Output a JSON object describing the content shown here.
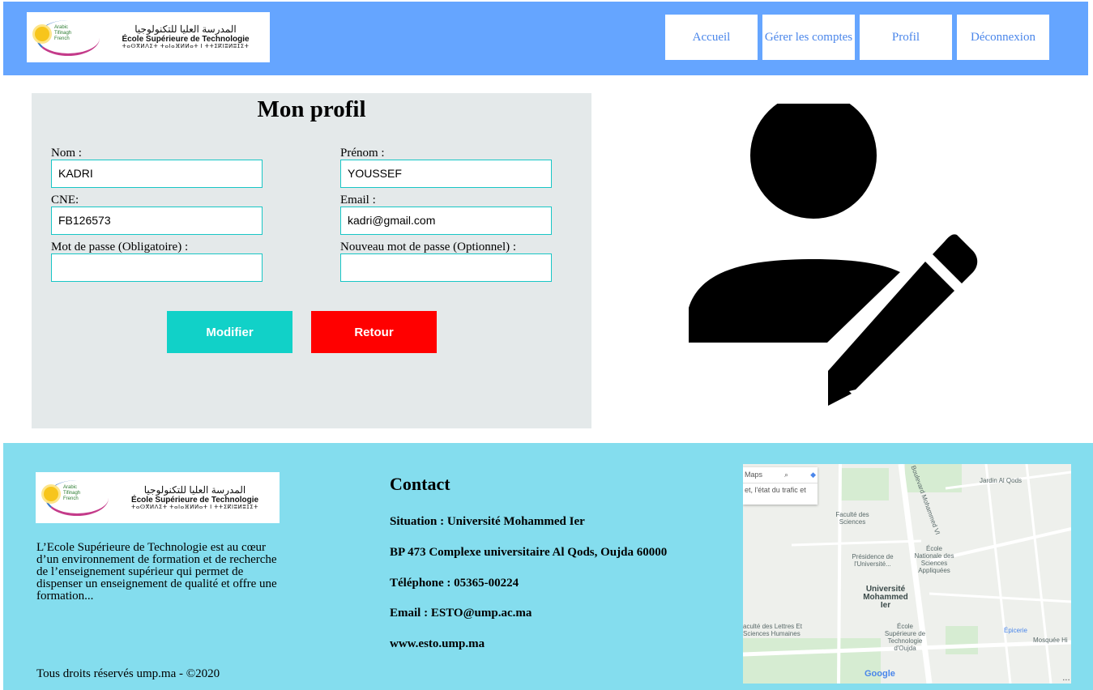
{
  "header": {
    "logo": {
      "arabic": "المدرسة العليا للتكنولوجيا",
      "french": "École Supérieure de Technologie",
      "tifinagh": "ⵜⴰⵙⴳⵍⴷⵉⵜ ⵜⴰⵏⴰⴼⵍⵍⴰⵜ ⵏ ⵜⵜⵉⴽⵏⵓⵍⵓⵊⵉⵜ"
    },
    "nav": [
      "Accueil",
      "Gérer les comptes",
      "Profil",
      "Déconnexion"
    ]
  },
  "profile": {
    "title": "Mon profil",
    "fields": {
      "nom": {
        "label": "Nom :",
        "value": "KADRI"
      },
      "prenom": {
        "label": "Prénom :",
        "value": "YOUSSEF"
      },
      "cne": {
        "label": "CNE:",
        "value": "FB126573"
      },
      "email": {
        "label": "Email :",
        "value": "kadri@gmail.com"
      },
      "password": {
        "label": "Mot de passe (Obligatoire) :",
        "value": ""
      },
      "new_password": {
        "label": "Nouveau mot de passe (Optionnel) :",
        "value": ""
      }
    },
    "buttons": {
      "modifier": "Modifier",
      "retour": "Retour"
    },
    "illustration_icon": "user-edit-icon"
  },
  "footer": {
    "about": "L’Ecole Supérieure de Technologie est au cœur d’un environnement de formation et de recherche de l’enseignement supérieur qui permet de dispenser un enseignement de qualité et offre une formation...",
    "copyright": "Tous droits réservés ump.ma - ©2020",
    "contact": {
      "title": "Contact",
      "lines": [
        "Situation : Université Mohammed Ier",
        "BP 473 Complexe universitaire Al Qods, Oujda 60000",
        "Téléphone : 05365-00224",
        "Email : ESTO@ump.ac.ma",
        "www.esto.ump.ma"
      ]
    },
    "map": {
      "search_partial": "et, l'état du trafic et",
      "maps_label": "Maps",
      "labels": {
        "jardin": "Jardin Al Qods",
        "faculte_sciences": "Faculté des Sciences",
        "presidence": "Présidence de l'Université...",
        "ecole_nationale": "École Nationale des Sciences Appliquées",
        "universite": "Université Mohammed Ier",
        "lettres": "aculté des Lettres Et Sciences Humaines",
        "est": "École Supérieure de Technologie d'Oujda",
        "epicerie": "Épicerie",
        "mosquee": "Mosquée Hi",
        "boulevard": "Boulevard Mohammed VI"
      },
      "google": "Google"
    }
  },
  "colors": {
    "header_bg": "#65a5ff",
    "nav_text": "#4a86ea",
    "panel_bg": "#e4e9ea",
    "input_border": "#18c6c6",
    "modifier_bg": "#11d1c8",
    "retour_bg": "#ff0000",
    "footer_bg": "#84ddee"
  }
}
